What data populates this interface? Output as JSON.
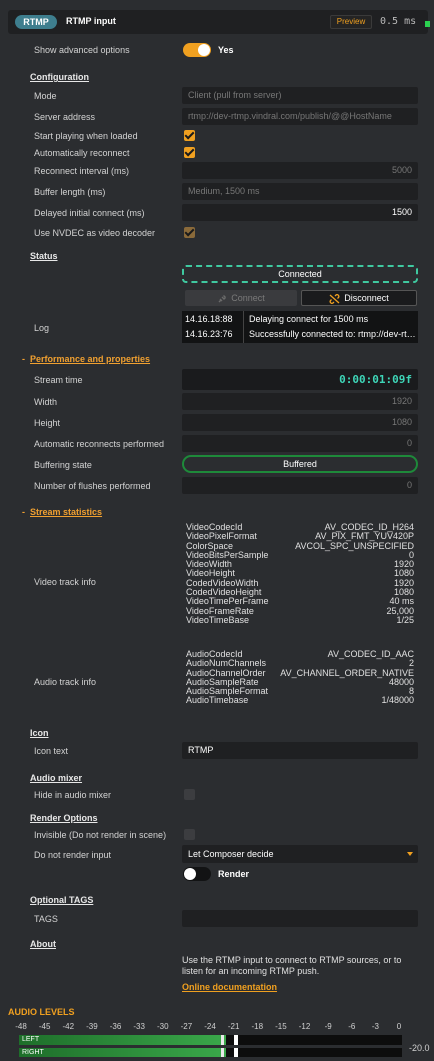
{
  "header": {
    "pill": "RTMP",
    "title": "RTMP input",
    "preview_label": "Preview",
    "latency": "0.5 ms"
  },
  "advanced": {
    "label": "Show advanced options",
    "value": "Yes",
    "enabled": true
  },
  "configuration": {
    "title": "Configuration",
    "mode": {
      "label": "Mode",
      "value": "Client (pull from server)"
    },
    "server_address": {
      "label": "Server address",
      "value": "rtmp://dev-rtmp.vindral.com/publish/@@HostName"
    },
    "start_playing": {
      "label": "Start playing when loaded",
      "checked": true
    },
    "auto_reconnect": {
      "label": "Automatically reconnect",
      "checked": true
    },
    "reconnect_interval": {
      "label": "Reconnect interval (ms)",
      "value": "5000"
    },
    "buffer_length": {
      "label": "Buffer length (ms)",
      "value": "Medium, 1500 ms"
    },
    "delayed_connect": {
      "label": "Delayed initial connect (ms)",
      "value": "1500"
    },
    "nvdec": {
      "label": "Use NVDEC as video decoder",
      "checked": true
    }
  },
  "status": {
    "title": "Status",
    "state": "Connected",
    "connect_label": "Connect",
    "disconnect_label": "Disconnect",
    "log_label": "Log",
    "log": [
      {
        "time": "14.16.18:88",
        "msg": "Delaying connect for 1500 ms"
      },
      {
        "time": "14.16.23:76",
        "msg": "Successfully connected to: rtmp://dev-rtmp.vindral.com"
      }
    ]
  },
  "performance": {
    "title": "Performance and properties",
    "stream_time": {
      "label": "Stream time",
      "value": "0:00:01:09f"
    },
    "width": {
      "label": "Width",
      "value": "1920"
    },
    "height": {
      "label": "Height",
      "value": "1080"
    },
    "auto_reconnects": {
      "label": "Automatic reconnects performed",
      "value": "0"
    },
    "buffering_state": {
      "label": "Buffering state",
      "value": "Buffered"
    },
    "flushes": {
      "label": "Number of flushes performed",
      "value": "0"
    }
  },
  "stats": {
    "title": "Stream statistics",
    "video_label": "Video track info",
    "video": [
      {
        "k": "VideoCodecId",
        "v": "AV_CODEC_ID_H264"
      },
      {
        "k": "VideoPixelFormat",
        "v": "AV_PIX_FMT_YUV420P"
      },
      {
        "k": "ColorSpace",
        "v": "AVCOL_SPC_UNSPECIFIED"
      },
      {
        "k": "VideoBitsPerSample",
        "v": "0"
      },
      {
        "k": "VideoWidth",
        "v": "1920"
      },
      {
        "k": "VideoHeight",
        "v": "1080"
      },
      {
        "k": "CodedVideoWidth",
        "v": "1920"
      },
      {
        "k": "CodedVideoHeight",
        "v": "1080"
      },
      {
        "k": "VideoTimePerFrame",
        "v": "40 ms"
      },
      {
        "k": "VideoFrameRate",
        "v": "25,000"
      },
      {
        "k": "VideoTimeBase",
        "v": "1/25"
      }
    ],
    "audio_label": "Audio track info",
    "audio": [
      {
        "k": "AudioCodecId",
        "v": "AV_CODEC_ID_AAC"
      },
      {
        "k": "AudioNumChannels",
        "v": "2"
      },
      {
        "k": "AudioChannelOrder",
        "v": "AV_CHANNEL_ORDER_NATIVE"
      },
      {
        "k": "AudioSampleRate",
        "v": "48000"
      },
      {
        "k": "AudioSampleFormat",
        "v": "8"
      },
      {
        "k": "AudioTimebase",
        "v": "1/48000"
      }
    ]
  },
  "icon": {
    "title": "Icon",
    "label": "Icon text",
    "value": "RTMP"
  },
  "audio_mixer": {
    "title": "Audio mixer",
    "hide_label": "Hide in audio mixer",
    "checked": false
  },
  "render": {
    "title": "Render Options",
    "invisible_label": "Invisible (Do not render in scene)",
    "invisible_checked": false,
    "no_render_label": "Do not render input",
    "no_render_value": "Let Composer decide",
    "render_toggle_label": "Render",
    "render_enabled": false
  },
  "tags": {
    "title": "Optional TAGS",
    "label": "TAGS",
    "value": ""
  },
  "about": {
    "title": "About",
    "text": "Use the RTMP input to connect to RTMP sources, or to listen for an incoming RTMP push.",
    "link": "Online documentation"
  },
  "audio_levels": {
    "title": "AUDIO LEVELS",
    "scale": [
      "-48",
      "-45",
      "-42",
      "-39",
      "-36",
      "-33",
      "-30",
      "-27",
      "-24",
      "-21",
      "-18",
      "-15",
      "-12",
      "-9",
      "-6",
      "-3",
      "0"
    ],
    "channels": [
      {
        "name": "LEFT",
        "level_db": -22.0,
        "peak_db": -21.0
      },
      {
        "name": "RIGHT",
        "level_db": -22.0,
        "peak_db": -21.0
      }
    ],
    "readout": "-20.0"
  },
  "colors": {
    "accent": "#f0a020",
    "teal": "#3ec9a0",
    "meter_green": "#3aa84a",
    "background": "#2b2d30"
  }
}
